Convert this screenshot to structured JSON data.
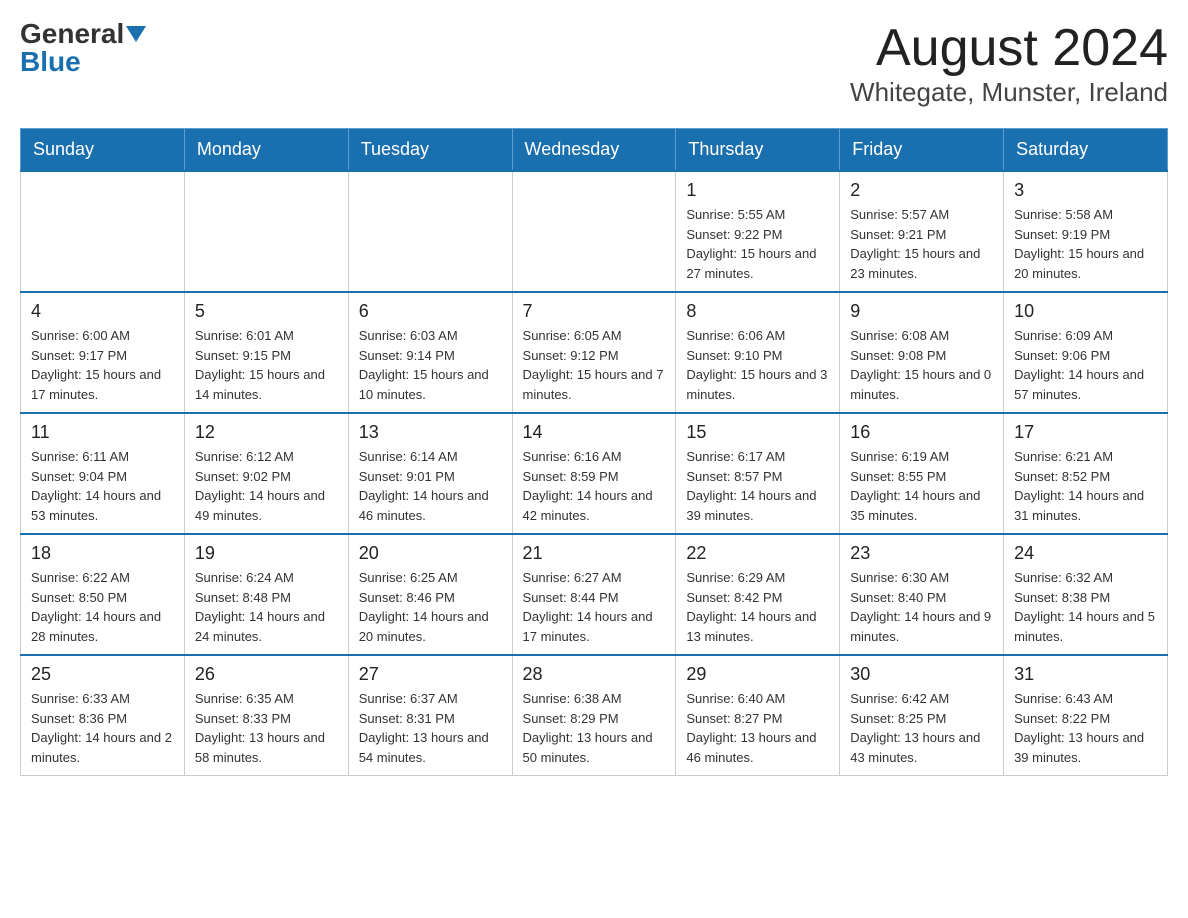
{
  "logo": {
    "general": "General",
    "blue": "Blue"
  },
  "title": "August 2024",
  "location": "Whitegate, Munster, Ireland",
  "days_of_week": [
    "Sunday",
    "Monday",
    "Tuesday",
    "Wednesday",
    "Thursday",
    "Friday",
    "Saturday"
  ],
  "weeks": [
    [
      {
        "day": "",
        "info": ""
      },
      {
        "day": "",
        "info": ""
      },
      {
        "day": "",
        "info": ""
      },
      {
        "day": "",
        "info": ""
      },
      {
        "day": "1",
        "info": "Sunrise: 5:55 AM\nSunset: 9:22 PM\nDaylight: 15 hours and 27 minutes."
      },
      {
        "day": "2",
        "info": "Sunrise: 5:57 AM\nSunset: 9:21 PM\nDaylight: 15 hours and 23 minutes."
      },
      {
        "day": "3",
        "info": "Sunrise: 5:58 AM\nSunset: 9:19 PM\nDaylight: 15 hours and 20 minutes."
      }
    ],
    [
      {
        "day": "4",
        "info": "Sunrise: 6:00 AM\nSunset: 9:17 PM\nDaylight: 15 hours and 17 minutes."
      },
      {
        "day": "5",
        "info": "Sunrise: 6:01 AM\nSunset: 9:15 PM\nDaylight: 15 hours and 14 minutes."
      },
      {
        "day": "6",
        "info": "Sunrise: 6:03 AM\nSunset: 9:14 PM\nDaylight: 15 hours and 10 minutes."
      },
      {
        "day": "7",
        "info": "Sunrise: 6:05 AM\nSunset: 9:12 PM\nDaylight: 15 hours and 7 minutes."
      },
      {
        "day": "8",
        "info": "Sunrise: 6:06 AM\nSunset: 9:10 PM\nDaylight: 15 hours and 3 minutes."
      },
      {
        "day": "9",
        "info": "Sunrise: 6:08 AM\nSunset: 9:08 PM\nDaylight: 15 hours and 0 minutes."
      },
      {
        "day": "10",
        "info": "Sunrise: 6:09 AM\nSunset: 9:06 PM\nDaylight: 14 hours and 57 minutes."
      }
    ],
    [
      {
        "day": "11",
        "info": "Sunrise: 6:11 AM\nSunset: 9:04 PM\nDaylight: 14 hours and 53 minutes."
      },
      {
        "day": "12",
        "info": "Sunrise: 6:12 AM\nSunset: 9:02 PM\nDaylight: 14 hours and 49 minutes."
      },
      {
        "day": "13",
        "info": "Sunrise: 6:14 AM\nSunset: 9:01 PM\nDaylight: 14 hours and 46 minutes."
      },
      {
        "day": "14",
        "info": "Sunrise: 6:16 AM\nSunset: 8:59 PM\nDaylight: 14 hours and 42 minutes."
      },
      {
        "day": "15",
        "info": "Sunrise: 6:17 AM\nSunset: 8:57 PM\nDaylight: 14 hours and 39 minutes."
      },
      {
        "day": "16",
        "info": "Sunrise: 6:19 AM\nSunset: 8:55 PM\nDaylight: 14 hours and 35 minutes."
      },
      {
        "day": "17",
        "info": "Sunrise: 6:21 AM\nSunset: 8:52 PM\nDaylight: 14 hours and 31 minutes."
      }
    ],
    [
      {
        "day": "18",
        "info": "Sunrise: 6:22 AM\nSunset: 8:50 PM\nDaylight: 14 hours and 28 minutes."
      },
      {
        "day": "19",
        "info": "Sunrise: 6:24 AM\nSunset: 8:48 PM\nDaylight: 14 hours and 24 minutes."
      },
      {
        "day": "20",
        "info": "Sunrise: 6:25 AM\nSunset: 8:46 PM\nDaylight: 14 hours and 20 minutes."
      },
      {
        "day": "21",
        "info": "Sunrise: 6:27 AM\nSunset: 8:44 PM\nDaylight: 14 hours and 17 minutes."
      },
      {
        "day": "22",
        "info": "Sunrise: 6:29 AM\nSunset: 8:42 PM\nDaylight: 14 hours and 13 minutes."
      },
      {
        "day": "23",
        "info": "Sunrise: 6:30 AM\nSunset: 8:40 PM\nDaylight: 14 hours and 9 minutes."
      },
      {
        "day": "24",
        "info": "Sunrise: 6:32 AM\nSunset: 8:38 PM\nDaylight: 14 hours and 5 minutes."
      }
    ],
    [
      {
        "day": "25",
        "info": "Sunrise: 6:33 AM\nSunset: 8:36 PM\nDaylight: 14 hours and 2 minutes."
      },
      {
        "day": "26",
        "info": "Sunrise: 6:35 AM\nSunset: 8:33 PM\nDaylight: 13 hours and 58 minutes."
      },
      {
        "day": "27",
        "info": "Sunrise: 6:37 AM\nSunset: 8:31 PM\nDaylight: 13 hours and 54 minutes."
      },
      {
        "day": "28",
        "info": "Sunrise: 6:38 AM\nSunset: 8:29 PM\nDaylight: 13 hours and 50 minutes."
      },
      {
        "day": "29",
        "info": "Sunrise: 6:40 AM\nSunset: 8:27 PM\nDaylight: 13 hours and 46 minutes."
      },
      {
        "day": "30",
        "info": "Sunrise: 6:42 AM\nSunset: 8:25 PM\nDaylight: 13 hours and 43 minutes."
      },
      {
        "day": "31",
        "info": "Sunrise: 6:43 AM\nSunset: 8:22 PM\nDaylight: 13 hours and 39 minutes."
      }
    ]
  ]
}
